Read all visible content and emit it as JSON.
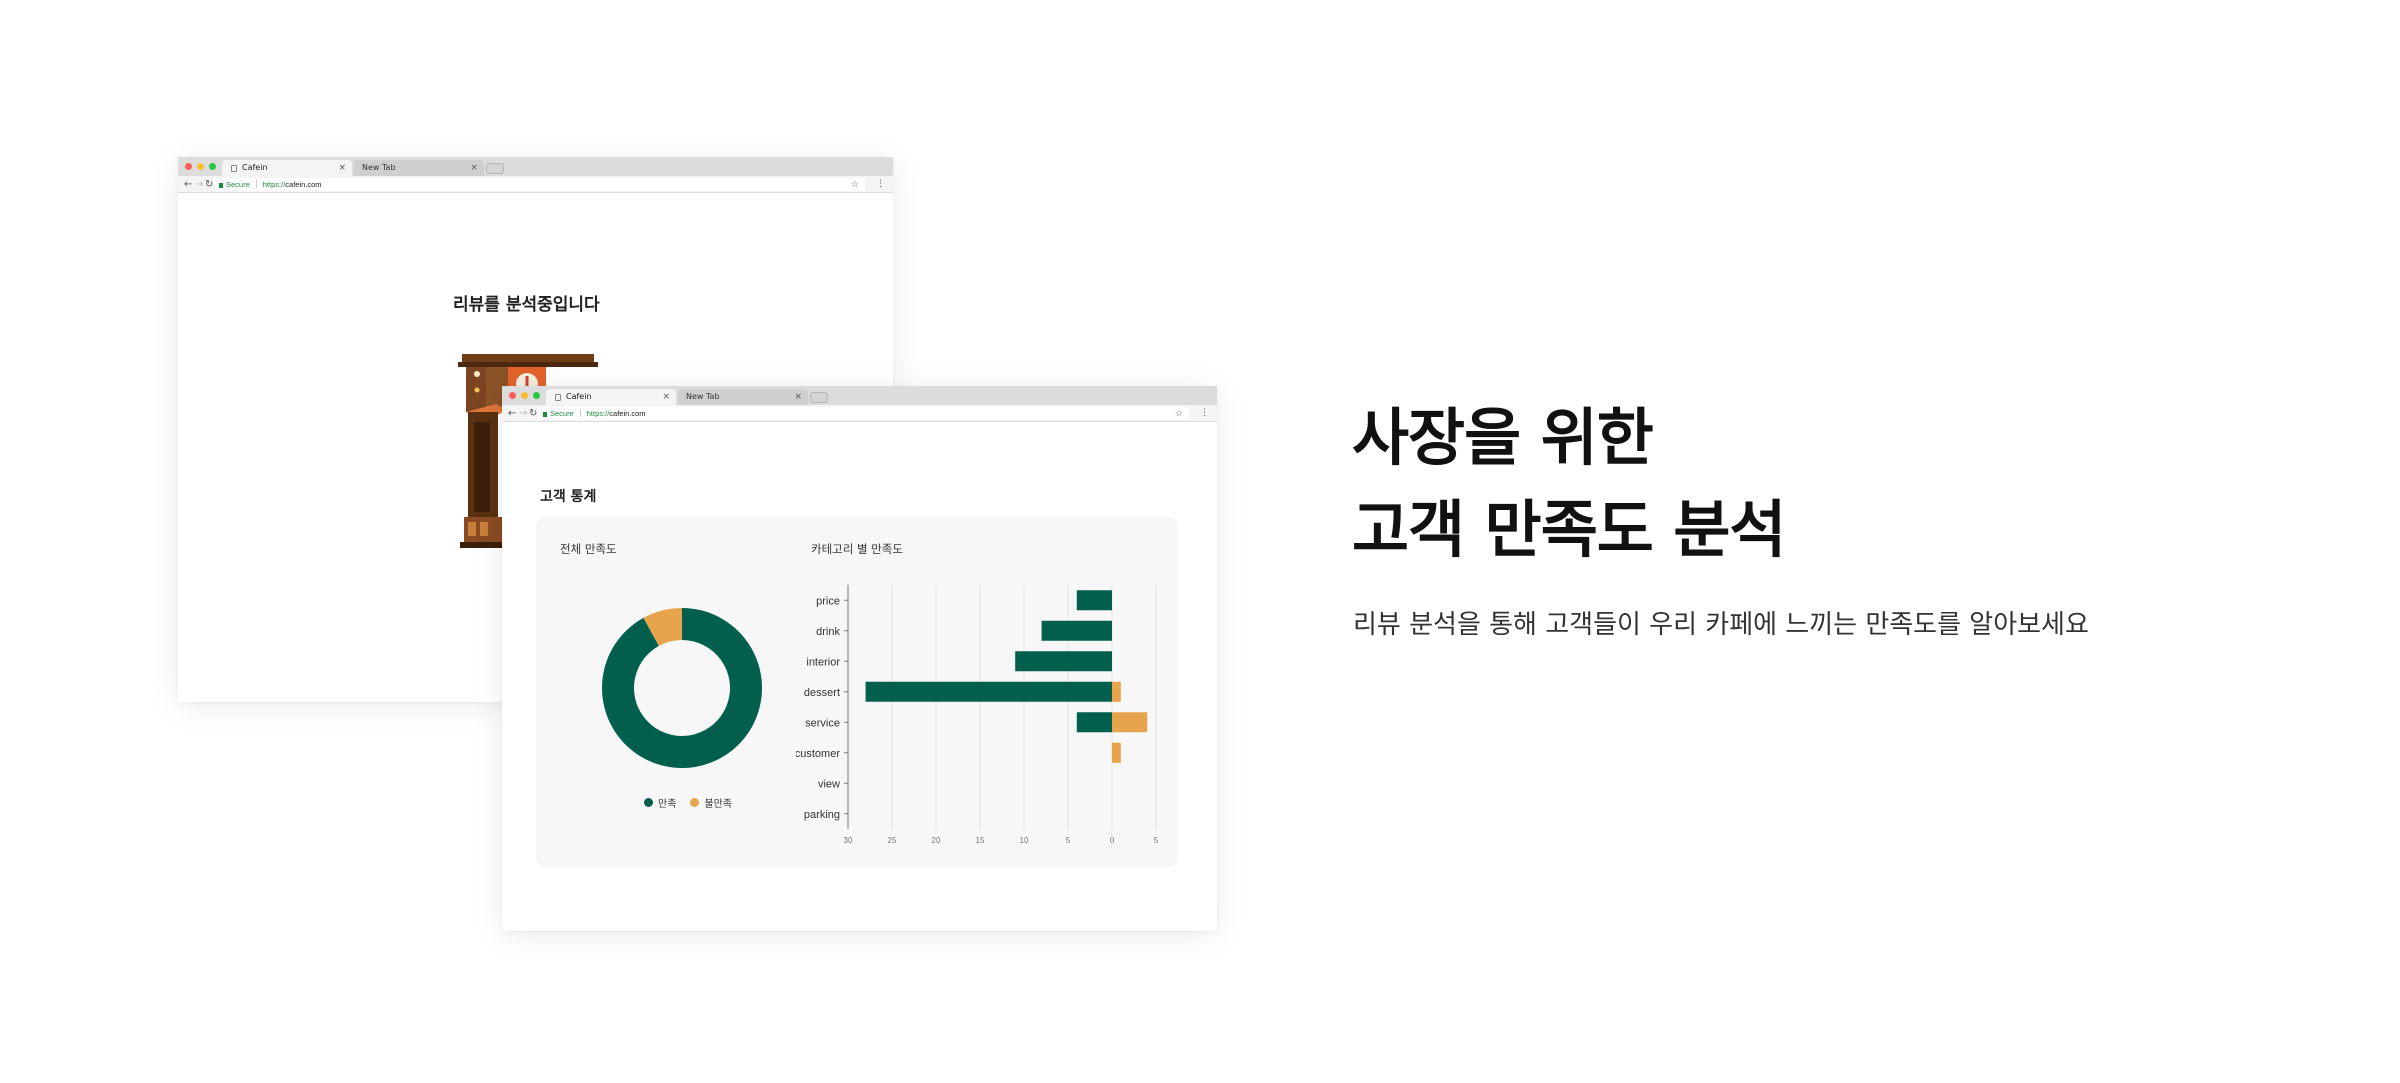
{
  "back_window": {
    "tabs": [
      {
        "label": "Cafein",
        "active": true
      },
      {
        "label": "New Tab",
        "active": false
      }
    ],
    "address": {
      "secure_label": "Secure",
      "scheme": "https://",
      "host": "cafein.com"
    },
    "loading_title": "리뷰를 분석중입니다"
  },
  "front_window": {
    "tabs": [
      {
        "label": "Cafein",
        "active": true
      },
      {
        "label": "New Tab",
        "active": false
      }
    ],
    "address": {
      "secure_label": "Secure",
      "scheme": "https://",
      "host": "cafein.com"
    },
    "section_title": "고객 통계",
    "overall_label": "전체 만족도",
    "category_label": "카테고리 별 만족도",
    "legend": [
      {
        "label": "만족",
        "color": "#025e4d"
      },
      {
        "label": "불만족",
        "color": "#e8a44c"
      }
    ]
  },
  "chart_data": [
    {
      "type": "pie",
      "title": "전체 만족도",
      "style": "donut",
      "labels": [
        "만족",
        "불만족"
      ],
      "values": [
        92,
        8
      ],
      "colors": [
        "#025e4d",
        "#e8a44c"
      ]
    },
    {
      "type": "bar",
      "title": "카테고리 별 만족도",
      "orientation": "horizontal",
      "categories": [
        "price",
        "drink",
        "interior",
        "dessert",
        "service",
        "customer",
        "view",
        "parking"
      ],
      "series": [
        {
          "name": "만족",
          "color": "#025e4d",
          "values": [
            -4,
            -8,
            -11,
            -28,
            -4,
            0,
            0,
            0
          ]
        },
        {
          "name": "불만족",
          "color": "#e8a44c",
          "values": [
            0,
            0,
            0,
            1,
            4,
            1,
            0,
            0
          ]
        }
      ],
      "xticks": [
        "30",
        "25",
        "20",
        "15",
        "10",
        "5",
        "0",
        "5"
      ],
      "xlim": [
        -30,
        5
      ],
      "grid": true
    }
  ],
  "hero": {
    "title_line1": "사장을 위한",
    "title_line2": "고객 만족도 분석",
    "description": "리뷰 분석을 통해 고객들이 우리 카페에 느끼는 만족도를 알아보세요"
  }
}
